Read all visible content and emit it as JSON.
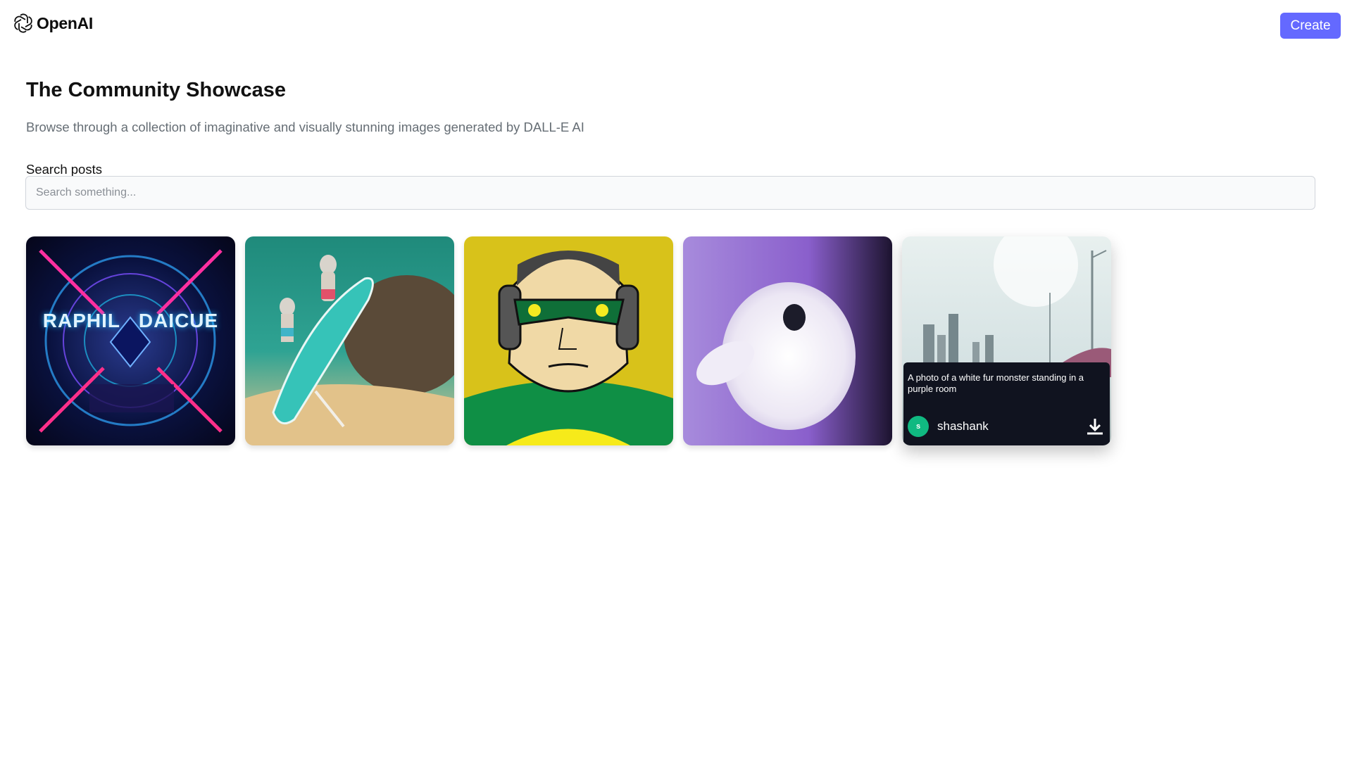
{
  "header": {
    "logo_text": "OpenAI",
    "logo_icon": "openai-logo-icon",
    "create_label": "Create",
    "accent_color": "#6469ff"
  },
  "hero": {
    "title": "The Community Showcase",
    "subtitle": "Browse through a collection of imaginative and visually stunning images generated by DALL-E AI"
  },
  "search": {
    "label": "Search posts",
    "placeholder": "Search something..."
  },
  "posts": [
    {
      "kind": "neon-cyberpunk-image",
      "overlay_text": "RAPHIL   DAICUE"
    },
    {
      "kind": "mice-surfing-image"
    },
    {
      "kind": "superhero-headphones-image"
    },
    {
      "kind": "fur-monster-image"
    },
    {
      "kind": "city-road-image",
      "hovered": true,
      "prompt": "A photo of a white fur monster standing in a purple room",
      "user_initial": "s",
      "username": "shashank",
      "avatar_color": "#10b981",
      "download_icon": "download-icon"
    }
  ]
}
